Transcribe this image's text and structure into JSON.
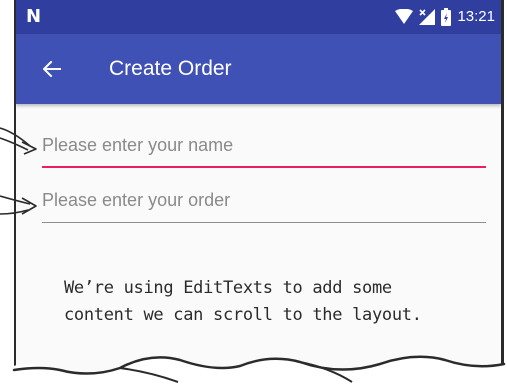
{
  "status_bar": {
    "logo": "N",
    "time": "13:21",
    "icons": [
      "wifi-icon",
      "no-signal-icon",
      "battery-charging-icon"
    ],
    "color": "#303f9f"
  },
  "app_bar": {
    "title": "Create Order",
    "back_icon": "back-arrow-icon",
    "color": "#3f51b5"
  },
  "form": {
    "name_field": {
      "placeholder": "Please enter your name",
      "value": "",
      "focused": true,
      "accent_color": "#e91e63"
    },
    "order_field": {
      "placeholder": "Please enter your order",
      "value": ""
    }
  },
  "annotation": {
    "line1": "We’re using EditTexts to add some",
    "line2": "content we can scroll to the layout."
  }
}
